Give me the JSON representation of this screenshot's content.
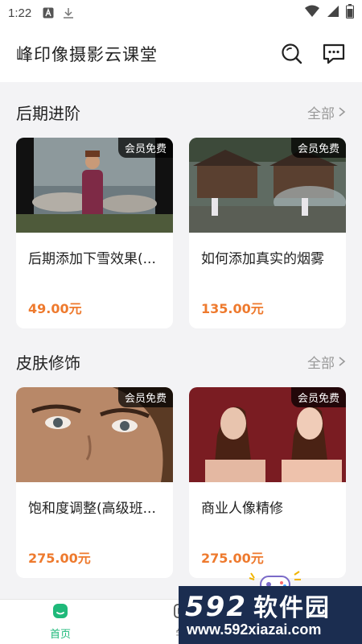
{
  "status_bar": {
    "time": "1:22",
    "icons_left": [
      "a-icon",
      "download-icon"
    ],
    "icons_right": [
      "wifi-icon",
      "signal-icon",
      "battery-icon"
    ]
  },
  "header": {
    "title": "峰印像摄影云课堂",
    "actions": [
      "search-icon",
      "message-icon"
    ]
  },
  "sections": [
    {
      "title": "后期进阶",
      "more_label": "全部",
      "cards": [
        {
          "badge": "会员免费",
          "title": "后期添加下雪效果(...",
          "price": "49.00元"
        },
        {
          "badge": "会员免费",
          "title": "如何添加真实的烟雾",
          "price": "135.00元"
        }
      ]
    },
    {
      "title": "皮肤修饰",
      "more_label": "全部",
      "cards": [
        {
          "badge": "会员免费",
          "title": "饱和度调整(高级班...",
          "price": "275.00元"
        },
        {
          "badge": "会员免费",
          "title": "商业人像精修",
          "price": "275.00元"
        }
      ]
    }
  ],
  "bottom_nav": {
    "items": [
      {
        "label": "首页",
        "icon": "home-icon",
        "active": true
      },
      {
        "label": "学",
        "icon": "study-icon",
        "active": false
      }
    ]
  },
  "watermark": {
    "brand_number": "592",
    "brand_text": "软件园",
    "url": "www.592xiazai.com"
  },
  "colors": {
    "accent_green": "#1fb97a",
    "price_orange": "#ee7a2e",
    "background": "#f3f3f5"
  }
}
